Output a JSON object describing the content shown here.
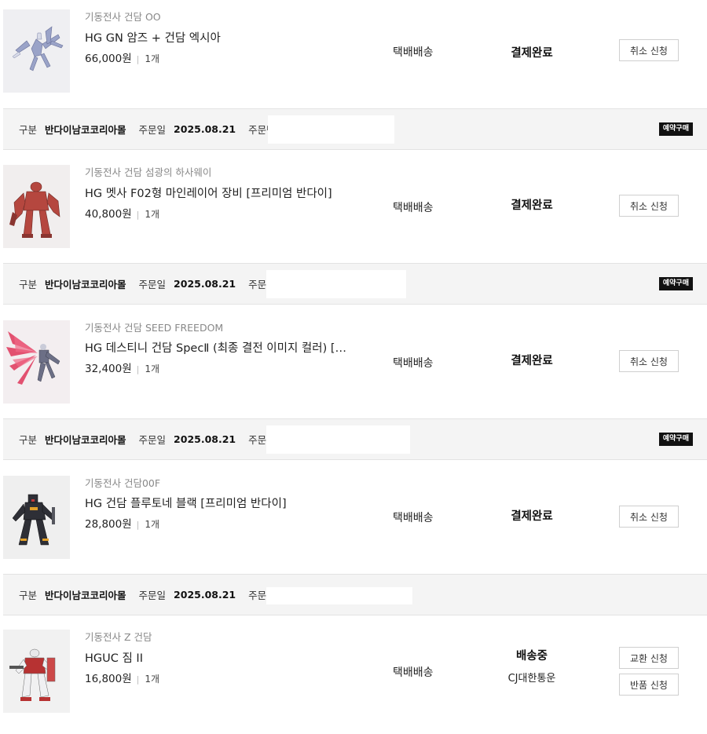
{
  "labels": {
    "division": "구분",
    "order_date": "주문일",
    "order_number": "주문번호",
    "reserve_badge": "예약구매",
    "quantity_separator": "|"
  },
  "items": [
    {
      "series": "기동전사 건담 OO",
      "name": "HG GN 암즈 + 건담 엑시아",
      "price": "66,000원",
      "qty": "1개",
      "shipping": "택배배송",
      "status": "결제완료",
      "buttons": [
        "취소 신청"
      ]
    },
    {
      "series": "기동전사 건담 섬광의 하사웨이",
      "name": "HG 멧사 F02형 마인레이어 장비 [프리미엄 반다이]",
      "price": "40,800원",
      "qty": "1개",
      "shipping": "택배배송",
      "status": "결제완료",
      "buttons": [
        "취소 신청"
      ]
    },
    {
      "series": "기동전사 건담 SEED FREEDOM",
      "name": "HG 데스티니 건담 SpecⅡ (최종 결전 이미지 컬러) […",
      "price": "32,400원",
      "qty": "1개",
      "shipping": "택배배송",
      "status": "결제완료",
      "buttons": [
        "취소 신청"
      ]
    },
    {
      "series": "기동전사 건담00F",
      "name": "HG 건담 플루토네 블랙 [프리미엄 반다이]",
      "price": "28,800원",
      "qty": "1개",
      "shipping": "택배배송",
      "status": "결제완료",
      "buttons": [
        "취소 신청"
      ]
    },
    {
      "series": "기동전사 Z 건담",
      "name": "HGUC 짐 II",
      "price": "16,800원",
      "qty": "1개",
      "shipping": "택배배송",
      "status": "배송중",
      "courier": "CJ대한통운",
      "buttons": [
        "교환 신청",
        "반품 신청"
      ]
    }
  ],
  "order_headers": [
    {
      "division": "반다이남코코리아몰",
      "date": "2025.08.21",
      "badge": "예약구매"
    },
    {
      "division": "반다이남코코리아몰",
      "date": "2025.08.21",
      "badge": "예약구매"
    },
    {
      "division": "반다이남코코리아몰",
      "date": "2025.08.21",
      "badge": "예약구매"
    },
    {
      "division": "반다이남코코리아몰",
      "date": "2025.08.21"
    }
  ],
  "icons": [
    "gundam-exia-thumb-icon",
    "messer-f02-thumb-icon",
    "destiny-specii-thumb-icon",
    "plutone-black-thumb-icon",
    "gm-ii-thumb-icon"
  ],
  "colors": {
    "header_bg": "#f4f4f4",
    "badge_bg": "#111111",
    "button_border": "#cfcfcf"
  }
}
